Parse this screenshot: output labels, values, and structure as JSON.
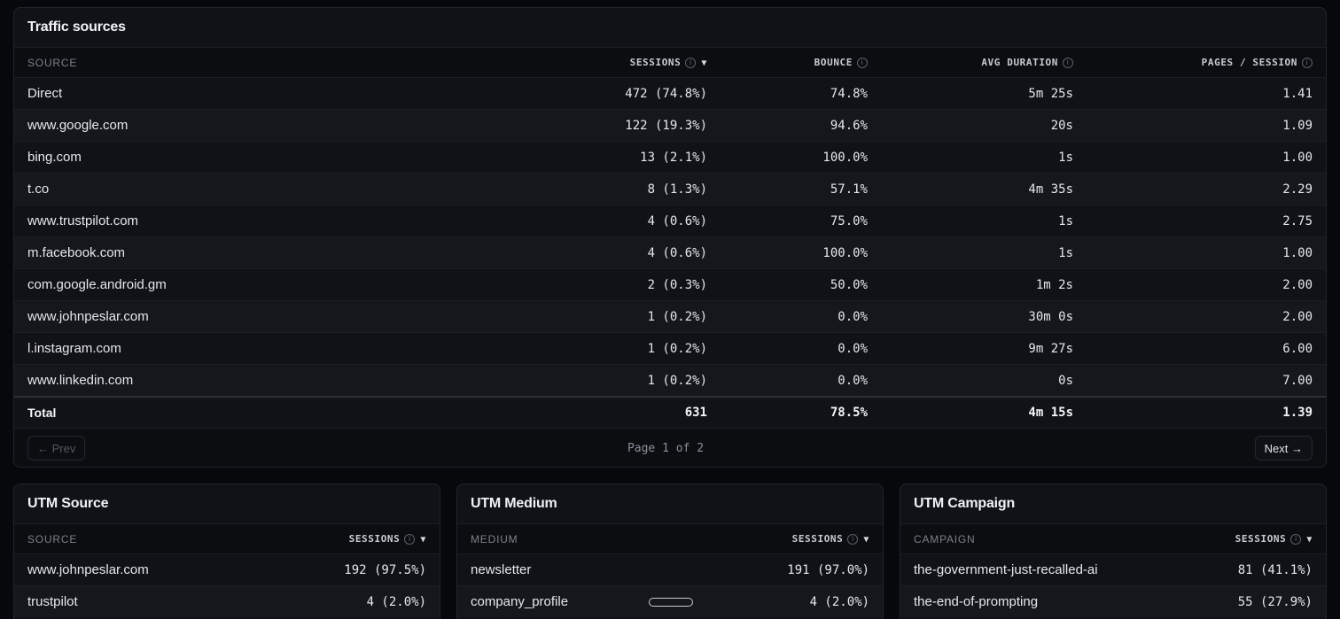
{
  "traffic": {
    "title": "Traffic sources",
    "headers": {
      "source": "SOURCE",
      "sessions": "SESSIONS",
      "bounce": "BOUNCE",
      "avg_duration": "AVG DURATION",
      "pages_per_session": "PAGES / SESSION"
    },
    "rows": [
      {
        "source": "Direct",
        "sessions": "472 (74.8%)",
        "bounce": "74.8%",
        "duration": "5m 25s",
        "pages": "1.41"
      },
      {
        "source": "www.google.com",
        "sessions": "122 (19.3%)",
        "bounce": "94.6%",
        "duration": "20s",
        "pages": "1.09"
      },
      {
        "source": "bing.com",
        "sessions": "13 (2.1%)",
        "bounce": "100.0%",
        "duration": "1s",
        "pages": "1.00"
      },
      {
        "source": "t.co",
        "sessions": "8 (1.3%)",
        "bounce": "57.1%",
        "duration": "4m 35s",
        "pages": "2.29"
      },
      {
        "source": "www.trustpilot.com",
        "sessions": "4 (0.6%)",
        "bounce": "75.0%",
        "duration": "1s",
        "pages": "2.75"
      },
      {
        "source": "m.facebook.com",
        "sessions": "4 (0.6%)",
        "bounce": "100.0%",
        "duration": "1s",
        "pages": "1.00"
      },
      {
        "source": "com.google.android.gm",
        "sessions": "2 (0.3%)",
        "bounce": "50.0%",
        "duration": "1m 2s",
        "pages": "2.00"
      },
      {
        "source": "www.johnpeslar.com",
        "sessions": "1 (0.2%)",
        "bounce": "0.0%",
        "duration": "30m 0s",
        "pages": "2.00"
      },
      {
        "source": "l.instagram.com",
        "sessions": "1 (0.2%)",
        "bounce": "0.0%",
        "duration": "9m 27s",
        "pages": "6.00"
      },
      {
        "source": "www.linkedin.com",
        "sessions": "1 (0.2%)",
        "bounce": "0.0%",
        "duration": "0s",
        "pages": "7.00"
      }
    ],
    "total": {
      "label": "Total",
      "sessions": "631",
      "bounce": "78.5%",
      "duration": "4m 15s",
      "pages": "1.39"
    },
    "pager": {
      "prev": "← Prev",
      "page_info": "Page 1 of 2",
      "next": "Next →"
    }
  },
  "utm_source": {
    "title": "UTM Source",
    "headers": {
      "label": "SOURCE",
      "sessions": "SESSIONS"
    },
    "rows": [
      {
        "label": "www.johnpeslar.com",
        "sessions": "192 (97.5%)"
      },
      {
        "label": "trustpilot",
        "sessions": "4 (2.0%)"
      }
    ]
  },
  "utm_medium": {
    "title": "UTM Medium",
    "headers": {
      "label": "MEDIUM",
      "sessions": "SESSIONS"
    },
    "rows": [
      {
        "label": "newsletter",
        "sessions": "191 (97.0%)"
      },
      {
        "label": "company_profile",
        "sessions": "4 (2.0%)"
      }
    ]
  },
  "utm_campaign": {
    "title": "UTM Campaign",
    "headers": {
      "label": "CAMPAIGN",
      "sessions": "SESSIONS"
    },
    "rows": [
      {
        "label": "the-government-just-recalled-ai",
        "sessions": "81 (41.1%)"
      },
      {
        "label": "the-end-of-prompting",
        "sessions": "55 (27.9%)"
      }
    ]
  },
  "icons": {
    "info": "info-icon",
    "sort": "sort-desc-icon"
  },
  "colors": {
    "background": "#07080c",
    "card": "#111217",
    "text": "#e8e9ee",
    "muted": "#7d808a"
  }
}
